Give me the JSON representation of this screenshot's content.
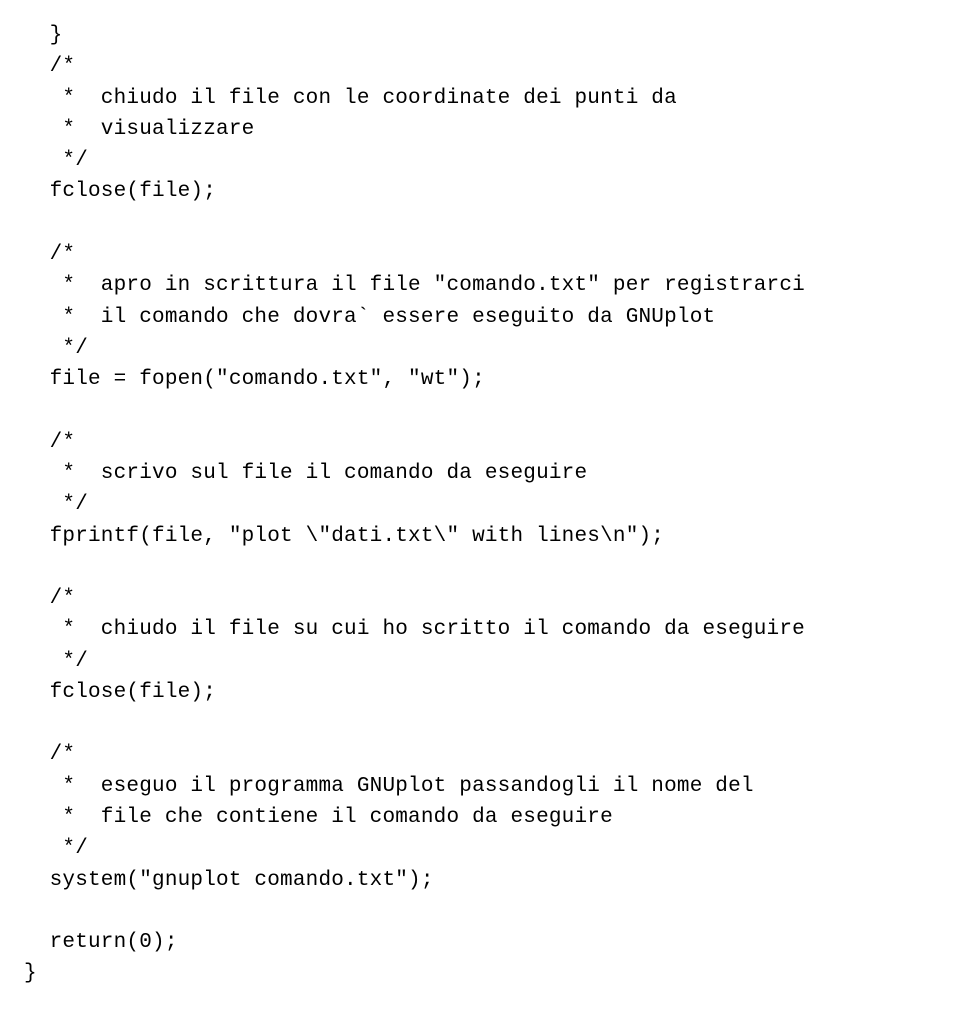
{
  "code": {
    "lines": [
      "  }",
      "  /*",
      "   *  chiudo il file con le coordinate dei punti da",
      "   *  visualizzare",
      "   */",
      "  fclose(file);",
      "",
      "  /*",
      "   *  apro in scrittura il file \"comando.txt\" per registrarci",
      "   *  il comando che dovra` essere eseguito da GNUplot",
      "   */",
      "  file = fopen(\"comando.txt\", \"wt\");",
      "",
      "  /*",
      "   *  scrivo sul file il comando da eseguire",
      "   */",
      "  fprintf(file, \"plot \\\"dati.txt\\\" with lines\\n\");",
      "",
      "  /*",
      "   *  chiudo il file su cui ho scritto il comando da eseguire",
      "   */",
      "  fclose(file);",
      "",
      "  /*",
      "   *  eseguo il programma GNUplot passandogli il nome del",
      "   *  file che contiene il comando da eseguire",
      "   */",
      "  system(\"gnuplot comando.txt\");",
      "",
      "  return(0);",
      "}"
    ]
  }
}
